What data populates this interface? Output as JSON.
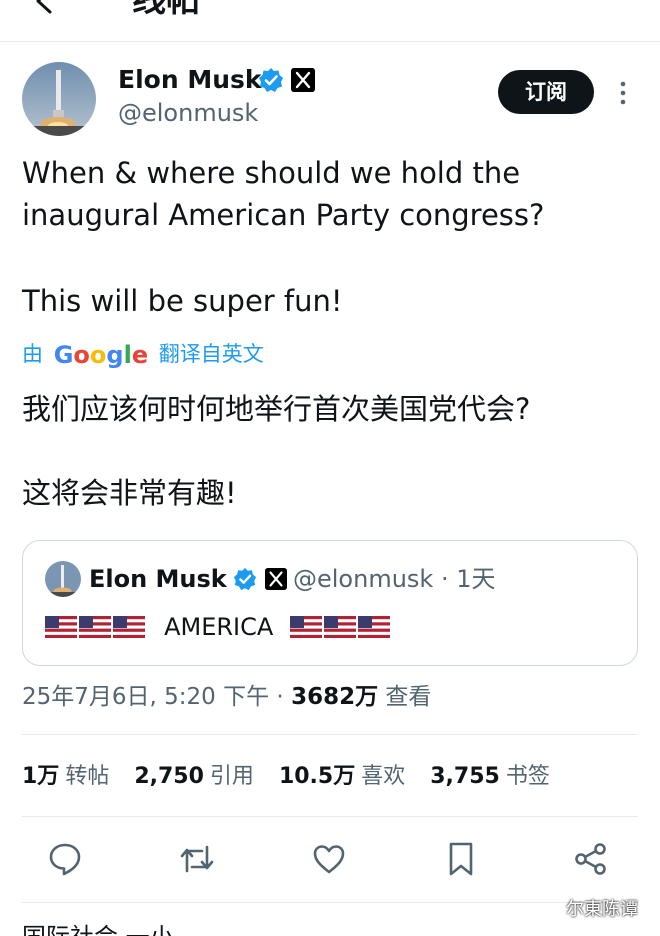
{
  "header": {
    "title": "线帖",
    "back_icon": "arrow-left-icon"
  },
  "tweet": {
    "author_name": "Elon Musk",
    "handle": "@elonmusk",
    "subscribe_label": "订阅",
    "text_line1": "When & where should we hold the",
    "text_line2": "inaugural American Party congress?",
    "text_line3": "This will be super fun!",
    "translate_prefix": "由",
    "translate_brand": "Google",
    "translate_suffix": "翻译自英文",
    "translated_line1": "我们应该何时何地举行首次美国党代会?",
    "translated_line2": "这将会非常有趣!",
    "timestamp": "25年7月6日, 5:20 下午 · ",
    "views_count": "3682万",
    "views_label": " 查看"
  },
  "quote": {
    "author_name": "Elon Musk",
    "meta": "@elonmusk · 1天",
    "word": "AMERICA"
  },
  "stats": [
    {
      "count": "1万",
      "label": "转帖"
    },
    {
      "count": "2,750",
      "label": "引用"
    },
    {
      "count": "10.5万",
      "label": "喜欢"
    },
    {
      "count": "3,755",
      "label": "书签"
    }
  ],
  "actions": [
    "reply-icon",
    "retweet-icon",
    "like-icon",
    "bookmark-icon",
    "share-icon"
  ],
  "watermark": "尔東陈谭",
  "next_tweet_partial": "国际社会 一小",
  "colors": {
    "accent": "#1d9bf0",
    "muted": "#536471",
    "text": "#0f1419",
    "border": "#cfd9de"
  }
}
